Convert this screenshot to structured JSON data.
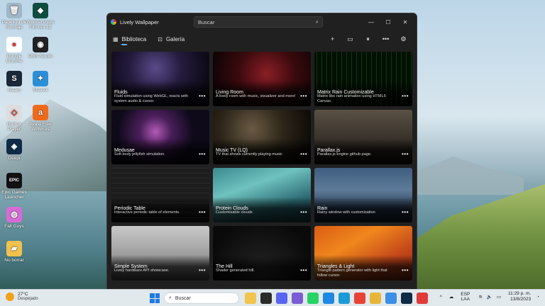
{
  "desktop": {
    "icons": [
      {
        "label": "Papelera de reciclaje",
        "color": "#9fb7c7",
        "glyph": "🗑"
      },
      {
        "label": "Wondershare Filmora 12",
        "color": "#0f4d3f",
        "glyph": "◆"
      },
      {
        "label": "Google Chrome",
        "color": "#ffffff",
        "glyph": "●"
      },
      {
        "label": "OBS Studio",
        "color": "#222222",
        "glyph": "◉"
      },
      {
        "label": "Steam",
        "color": "#1b2838",
        "glyph": "S"
      },
      {
        "label": "ShareX",
        "color": "#2a8fd6",
        "glyph": "✦"
      },
      {
        "label": "Roblox Player",
        "color": "#dddddd",
        "glyph": "◇"
      },
      {
        "label": "Avast Free Antivirus",
        "color": "#f06a1c",
        "glyph": "a"
      },
      {
        "label": "Deepl",
        "color": "#0f2b46",
        "glyph": "◈"
      },
      {
        "label": "Epic Games Launcher",
        "color": "#111111",
        "glyph": "EPIC"
      },
      {
        "label": "Fall Guys",
        "color": "#d66bd6",
        "glyph": "◍"
      },
      {
        "label": "No borrar",
        "color": "#f2c14e",
        "glyph": "▰"
      }
    ]
  },
  "window": {
    "title": "Lively Wallpaper",
    "search_placeholder": "Buscar",
    "controls": {
      "minimize": "—",
      "maximize": "☐",
      "close": "✕"
    },
    "tabs": [
      {
        "label": "Biblioteca",
        "icon": "grid-icon",
        "glyph": "▦",
        "active": true
      },
      {
        "label": "Galería",
        "icon": "gallery-bag-icon",
        "glyph": "⊡",
        "active": false
      }
    ],
    "toolbar": [
      {
        "name": "add-icon",
        "glyph": "+"
      },
      {
        "name": "display-icon",
        "glyph": "▭"
      },
      {
        "name": "pause-icon",
        "glyph": "⏸"
      },
      {
        "name": "more-icon",
        "glyph": "•••"
      },
      {
        "name": "settings-gear-icon",
        "glyph": "⚙"
      }
    ]
  },
  "library": [
    {
      "title": "Fluids",
      "desc": "Fluid simulation using WebGL, reacts with system audio & cursor.",
      "bg": "bg-fluids"
    },
    {
      "title": "Living Room",
      "desc": "A lively room with music, visualizer and more!",
      "bg": "bg-living"
    },
    {
      "title": "Matrix Rain Customizable",
      "desc": "Matrix like rain animation using HTML5 Canvas.",
      "bg": "bg-matrix"
    },
    {
      "title": "Medusae",
      "desc": "Soft body jellyfish simulation.",
      "bg": "bg-medusae"
    },
    {
      "title": "Music TV (LQ)",
      "desc": "TV that shows currently playing music",
      "bg": "bg-musictv"
    },
    {
      "title": "Parallax.js",
      "desc": "Parallax.js engine github page.",
      "bg": "bg-parallax"
    },
    {
      "title": "Periodic Table",
      "desc": "Interactive periodic table of elements.",
      "bg": "bg-periodic"
    },
    {
      "title": "Protein Clouds",
      "desc": "Customisable clouds",
      "bg": "bg-protein"
    },
    {
      "title": "Rain",
      "desc": "Rainy window with customisation",
      "bg": "bg-rain"
    },
    {
      "title": "Simple System",
      "desc": "Lively hardware API showcase.",
      "bg": "bg-simple"
    },
    {
      "title": "The Hill",
      "desc": "Shader generated hill.",
      "bg": "bg-hill"
    },
    {
      "title": "Triangles & Light",
      "desc": "Triangle pattern generator with light that follow cursor.",
      "bg": "bg-triangles"
    }
  ],
  "card_more": "•••",
  "taskbar": {
    "weather_temp": "27°C",
    "weather_desc": "Despejado",
    "search_label": "Buscar",
    "apps": [
      {
        "name": "file-explorer-icon",
        "color": "#f3c44c"
      },
      {
        "name": "terminal-icon",
        "color": "#2b2b2b"
      },
      {
        "name": "discord-icon",
        "color": "#5865f2"
      },
      {
        "name": "copilot-icon",
        "color": "#7b5cd6"
      },
      {
        "name": "whatsapp-icon",
        "color": "#25d366"
      },
      {
        "name": "store-icon",
        "color": "#1e88e5"
      },
      {
        "name": "ms-edge-icon",
        "color": "#1b9ad6"
      },
      {
        "name": "chrome-icon",
        "color": "#e84335"
      },
      {
        "name": "folder-icon",
        "color": "#e8b53a"
      },
      {
        "name": "photos-icon",
        "color": "#3c8ee6"
      },
      {
        "name": "deepl-icon",
        "color": "#0f2b46"
      },
      {
        "name": "lively-icon",
        "color": "#e03a3a"
      }
    ],
    "lang_top": "ESP",
    "lang_bottom": "LAA",
    "time": "11:29 p. m.",
    "date": "13/8/2023"
  }
}
